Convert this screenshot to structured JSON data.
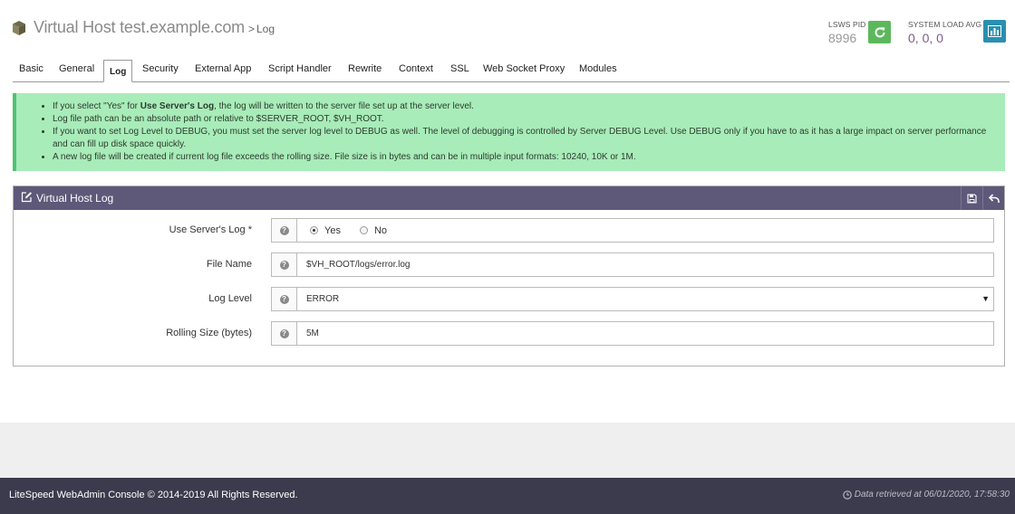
{
  "header": {
    "title": "Virtual Host test.example.com",
    "sep": ">",
    "subtitle": "Log",
    "pid_label": "LSWS PID",
    "pid_value": "8996",
    "load_label": "SYSTEM LOAD AVG",
    "load_value": "0, 0, 0",
    "icons": [
      "cube-icon",
      "refresh-icon",
      "bar-chart-icon"
    ],
    "refresh_color": "#5cb85c",
    "chart_color": "#2a8fb0"
  },
  "tabs": [
    "Basic",
    "General",
    "Log",
    "Security",
    "External App",
    "Script Handler",
    "Rewrite",
    "Context",
    "SSL",
    "Web Socket Proxy",
    "Modules"
  ],
  "active_tab": "Log",
  "alert": {
    "items": [
      {
        "pre": "If you select \"Yes\" for ",
        "bold": "Use Server's Log",
        "post": ", the log will be written to the server file set up at the server level."
      },
      {
        "pre": "Log file path can be an absolute path or relative to $SERVER_ROOT, $VH_ROOT.",
        "bold": "",
        "post": ""
      },
      {
        "pre": "If you want to set Log Level to DEBUG, you must set the server log level to DEBUG as well. The level of debugging is controlled by Server DEBUG Level. Use DEBUG only if you have to as it has a large impact on server performance and can fill up disk space quickly.",
        "bold": "",
        "post": ""
      },
      {
        "pre": "A new log file will be created if current log file exceeds the rolling size. File size is in bytes and can be in multiple input formats: 10240, 10K or 1M.",
        "bold": "",
        "post": ""
      }
    ],
    "bg_color": "#a8ecb9",
    "border_color": "#4fc373"
  },
  "panel": {
    "title": "Virtual Host Log",
    "header_color": "#5e5879",
    "icons": [
      "edit-icon",
      "save-icon",
      "back-icon"
    ],
    "fields": {
      "use_server_log": {
        "label": "Use Server's Log *",
        "yes": "Yes",
        "no": "No",
        "selected": "Yes"
      },
      "file_name": {
        "label": "File Name",
        "value": "$VH_ROOT/logs/error.log"
      },
      "log_level": {
        "label": "Log Level",
        "value": "ERROR",
        "caret": "▼"
      },
      "rolling_size": {
        "label": "Rolling Size (bytes)",
        "value": "5M"
      }
    }
  },
  "footer": {
    "copyright": "LiteSpeed WebAdmin Console © 2014-2019 All Rights Reserved.",
    "retrieved": "Data retrieved at 06/01/2020, 17:58:30",
    "bg_color": "#3c3b4d"
  }
}
